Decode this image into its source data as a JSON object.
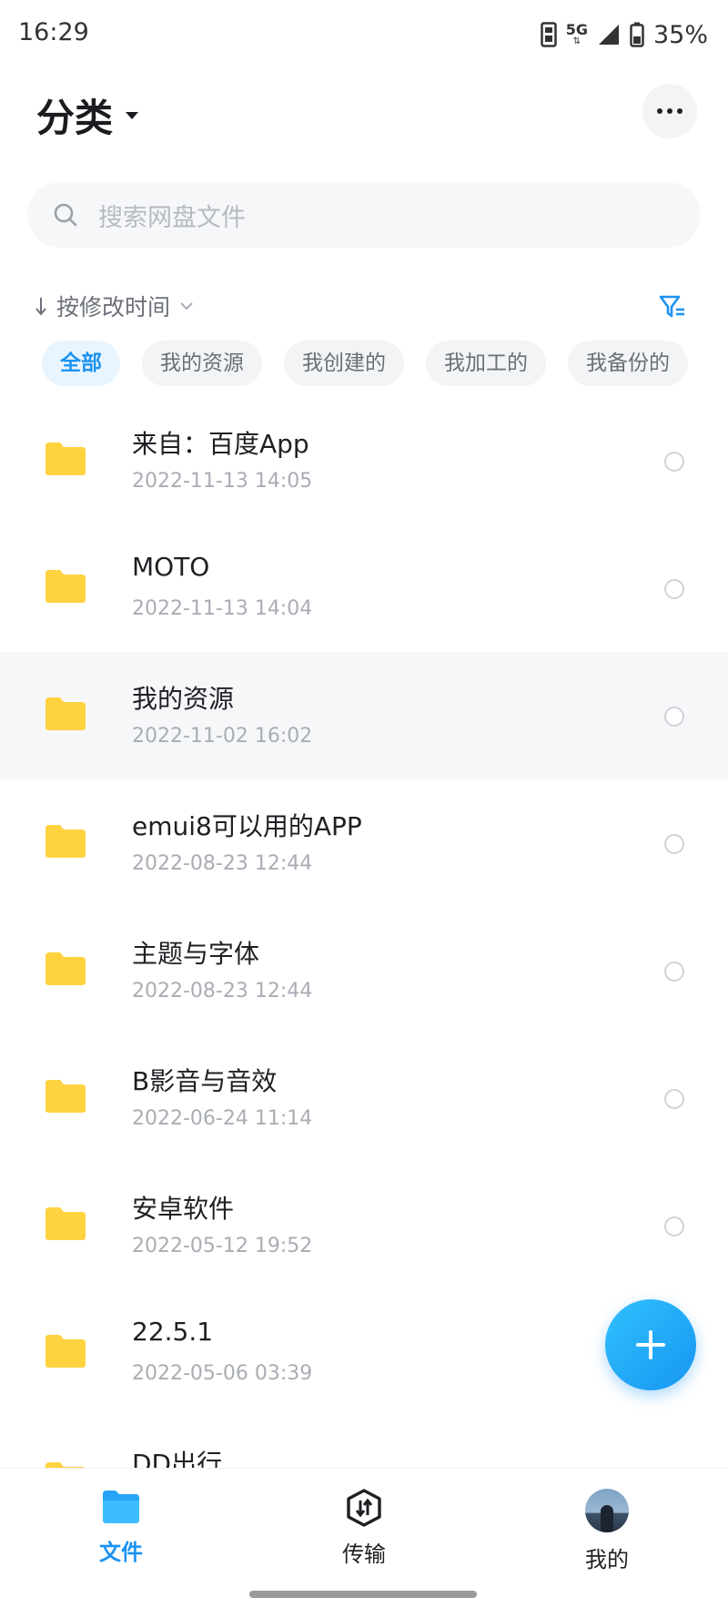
{
  "status_bar": {
    "time": "16:29",
    "network": "5G",
    "battery": "35%"
  },
  "header": {
    "title": "分类"
  },
  "search": {
    "placeholder": "搜索网盘文件"
  },
  "sort": {
    "label": "按修改时间"
  },
  "chips": [
    "全部",
    "我的资源",
    "我创建的",
    "我加工的",
    "我备份的"
  ],
  "files": [
    {
      "name": "来自：百度App",
      "date": "2022-11-13  14:05"
    },
    {
      "name": "MOTO",
      "date": "2022-11-13  14:04"
    },
    {
      "name": "我的资源",
      "date": "2022-11-02  16:02"
    },
    {
      "name": "emui8可以用的APP",
      "date": "2022-08-23  12:44"
    },
    {
      "name": "主题与字体",
      "date": "2022-08-23  12:44"
    },
    {
      "name": "B影音与音效",
      "date": "2022-06-24  11:14"
    },
    {
      "name": "安卓软件",
      "date": "2022-05-12  19:52"
    },
    {
      "name": "22.5.1",
      "date": "2022-05-06  03:39"
    },
    {
      "name": "DD出行",
      "date": ""
    }
  ],
  "bottom_nav": {
    "files": "文件",
    "transfer": "传输",
    "mine": "我的"
  },
  "colors": {
    "accent": "#1b93f3",
    "folder": "#ffd23f",
    "highlight_row": "#f6f7f9"
  }
}
